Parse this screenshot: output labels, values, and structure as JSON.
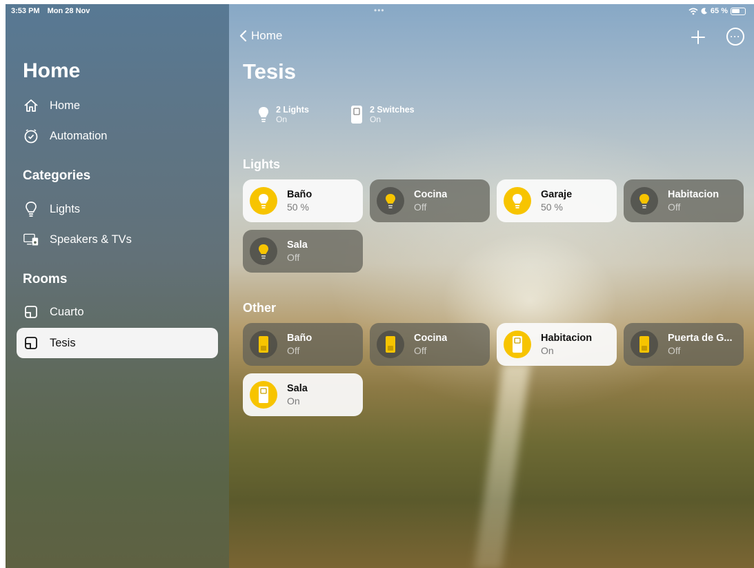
{
  "status_bar": {
    "time": "3:53 PM",
    "date": "Mon 28 Nov",
    "battery": "65 %",
    "multitask_dots": "•••"
  },
  "sidebar": {
    "title": "Home",
    "items": [
      {
        "label": "Home",
        "icon": "house-icon"
      },
      {
        "label": "Automation",
        "icon": "clock-icon"
      }
    ],
    "categories_label": "Categories",
    "categories": [
      {
        "label": "Lights",
        "icon": "lightbulb-icon"
      },
      {
        "label": "Speakers & TVs",
        "icon": "speakers-tv-icon"
      }
    ],
    "rooms_label": "Rooms",
    "rooms": [
      {
        "label": "Cuarto",
        "icon": "room-icon",
        "selected": false
      },
      {
        "label": "Tesis",
        "icon": "room-icon",
        "selected": true
      }
    ]
  },
  "header": {
    "back_label": "Home",
    "title": "Tesis"
  },
  "summary": [
    {
      "title": "2 Lights",
      "status": "On",
      "icon": "lightbulb-icon"
    },
    {
      "title": "2 Switches",
      "status": "On",
      "icon": "switch-icon"
    }
  ],
  "lights_section": {
    "label": "Lights",
    "tiles": [
      {
        "name": "Baño",
        "state": "50 %",
        "on": true
      },
      {
        "name": "Cocina",
        "state": "Off",
        "on": false
      },
      {
        "name": "Garaje",
        "state": "50 %",
        "on": true
      },
      {
        "name": "Habitacion",
        "state": "Off",
        "on": false
      },
      {
        "name": "Sala",
        "state": "Off",
        "on": false
      }
    ]
  },
  "other_section": {
    "label": "Other",
    "tiles": [
      {
        "name": "Baño",
        "state": "Off",
        "on": false
      },
      {
        "name": "Cocina",
        "state": "Off",
        "on": false
      },
      {
        "name": "Habitacion",
        "state": "On",
        "on": true
      },
      {
        "name": "Puerta de G...",
        "state": "Off",
        "on": false
      },
      {
        "name": "Sala",
        "state": "On",
        "on": true
      }
    ]
  },
  "colors": {
    "accent_yellow": "#f7c400",
    "tile_on": "#fafafa",
    "tile_off": "#5f5f58"
  }
}
